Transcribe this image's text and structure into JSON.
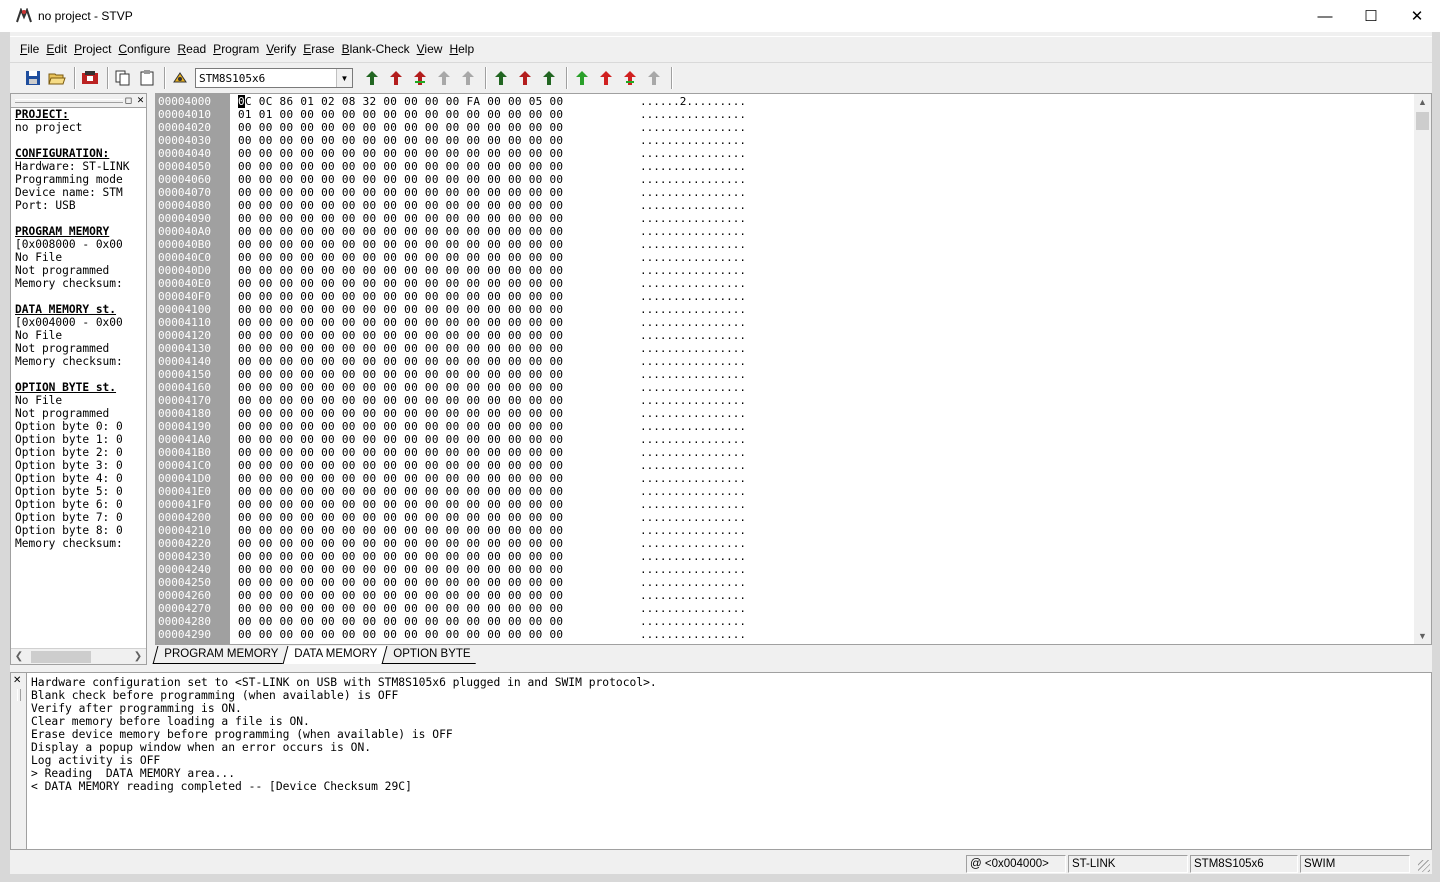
{
  "window": {
    "title": "no project - STVP"
  },
  "menu": [
    {
      "label": "File",
      "u": "F",
      "rest": "ile"
    },
    {
      "label": "Edit",
      "u": "E",
      "rest": "dit"
    },
    {
      "label": "Project",
      "u": "P",
      "rest": "roject"
    },
    {
      "label": "Configure",
      "u": "C",
      "rest": "onfigure"
    },
    {
      "label": "Read",
      "u": "R",
      "rest": "ead"
    },
    {
      "label": "Program",
      "u": "P",
      "rest": "rogram"
    },
    {
      "label": "Verify",
      "u": "V",
      "rest": "erify"
    },
    {
      "label": "Erase",
      "u": "E",
      "rest": "rase"
    },
    {
      "label": "Blank-Check",
      "u": "B",
      "rest": "lank-Check"
    },
    {
      "label": "View",
      "u": "V",
      "rest": "iew"
    },
    {
      "label": "Help",
      "u": "H",
      "rest": "elp"
    }
  ],
  "toolbar": {
    "device": "STM8S105x6"
  },
  "left_panel": {
    "lines": [
      {
        "t": "PROJECT:",
        "h": true
      },
      {
        "t": "no project"
      },
      {
        "t": ""
      },
      {
        "t": "CONFIGURATION:",
        "h": true
      },
      {
        "t": "Hardware: ST-LINK"
      },
      {
        "t": "Programming mode"
      },
      {
        "t": "Device name: STM"
      },
      {
        "t": "Port: USB"
      },
      {
        "t": ""
      },
      {
        "t": "PROGRAM MEMORY",
        "h": true
      },
      {
        "t": "[0x008000 - 0x00"
      },
      {
        "t": "No File"
      },
      {
        "t": "Not programmed"
      },
      {
        "t": "Memory checksum:"
      },
      {
        "t": ""
      },
      {
        "t": "DATA MEMORY st.",
        "h": true
      },
      {
        "t": "[0x004000 - 0x00"
      },
      {
        "t": "No File"
      },
      {
        "t": "Not programmed"
      },
      {
        "t": "Memory checksum:"
      },
      {
        "t": ""
      },
      {
        "t": "OPTION BYTE st.",
        "h": true
      },
      {
        "t": "No File"
      },
      {
        "t": "Not programmed"
      },
      {
        "t": "Option byte 0: 0"
      },
      {
        "t": "Option byte 1: 0"
      },
      {
        "t": "Option byte 2: 0"
      },
      {
        "t": "Option byte 3: 0"
      },
      {
        "t": "Option byte 4: 0"
      },
      {
        "t": "Option byte 5: 0"
      },
      {
        "t": "Option byte 6: 0"
      },
      {
        "t": "Option byte 7: 0"
      },
      {
        "t": "Option byte 8: 0"
      },
      {
        "t": "Memory checksum:"
      }
    ]
  },
  "hex": {
    "rows": [
      {
        "addr": "00004000",
        "bytes": "0C 0C 86 01 02 08 32 00 00 00 00 FA 00 00 05 00",
        "ascii": "......2........."
      },
      {
        "addr": "00004010",
        "bytes": "01 01 00 00 00 00 00 00 00 00 00 00 00 00 00 00",
        "ascii": "................"
      },
      {
        "addr": "00004020",
        "bytes": "00 00 00 00 00 00 00 00 00 00 00 00 00 00 00 00",
        "ascii": "................"
      },
      {
        "addr": "00004030",
        "bytes": "00 00 00 00 00 00 00 00 00 00 00 00 00 00 00 00",
        "ascii": "................"
      },
      {
        "addr": "00004040",
        "bytes": "00 00 00 00 00 00 00 00 00 00 00 00 00 00 00 00",
        "ascii": "................"
      },
      {
        "addr": "00004050",
        "bytes": "00 00 00 00 00 00 00 00 00 00 00 00 00 00 00 00",
        "ascii": "................"
      },
      {
        "addr": "00004060",
        "bytes": "00 00 00 00 00 00 00 00 00 00 00 00 00 00 00 00",
        "ascii": "................"
      },
      {
        "addr": "00004070",
        "bytes": "00 00 00 00 00 00 00 00 00 00 00 00 00 00 00 00",
        "ascii": "................"
      },
      {
        "addr": "00004080",
        "bytes": "00 00 00 00 00 00 00 00 00 00 00 00 00 00 00 00",
        "ascii": "................"
      },
      {
        "addr": "00004090",
        "bytes": "00 00 00 00 00 00 00 00 00 00 00 00 00 00 00 00",
        "ascii": "................"
      },
      {
        "addr": "000040A0",
        "bytes": "00 00 00 00 00 00 00 00 00 00 00 00 00 00 00 00",
        "ascii": "................"
      },
      {
        "addr": "000040B0",
        "bytes": "00 00 00 00 00 00 00 00 00 00 00 00 00 00 00 00",
        "ascii": "................"
      },
      {
        "addr": "000040C0",
        "bytes": "00 00 00 00 00 00 00 00 00 00 00 00 00 00 00 00",
        "ascii": "................"
      },
      {
        "addr": "000040D0",
        "bytes": "00 00 00 00 00 00 00 00 00 00 00 00 00 00 00 00",
        "ascii": "................"
      },
      {
        "addr": "000040E0",
        "bytes": "00 00 00 00 00 00 00 00 00 00 00 00 00 00 00 00",
        "ascii": "................"
      },
      {
        "addr": "000040F0",
        "bytes": "00 00 00 00 00 00 00 00 00 00 00 00 00 00 00 00",
        "ascii": "................"
      },
      {
        "addr": "00004100",
        "bytes": "00 00 00 00 00 00 00 00 00 00 00 00 00 00 00 00",
        "ascii": "................"
      },
      {
        "addr": "00004110",
        "bytes": "00 00 00 00 00 00 00 00 00 00 00 00 00 00 00 00",
        "ascii": "................"
      },
      {
        "addr": "00004120",
        "bytes": "00 00 00 00 00 00 00 00 00 00 00 00 00 00 00 00",
        "ascii": "................"
      },
      {
        "addr": "00004130",
        "bytes": "00 00 00 00 00 00 00 00 00 00 00 00 00 00 00 00",
        "ascii": "................"
      },
      {
        "addr": "00004140",
        "bytes": "00 00 00 00 00 00 00 00 00 00 00 00 00 00 00 00",
        "ascii": "................"
      },
      {
        "addr": "00004150",
        "bytes": "00 00 00 00 00 00 00 00 00 00 00 00 00 00 00 00",
        "ascii": "................"
      },
      {
        "addr": "00004160",
        "bytes": "00 00 00 00 00 00 00 00 00 00 00 00 00 00 00 00",
        "ascii": "................"
      },
      {
        "addr": "00004170",
        "bytes": "00 00 00 00 00 00 00 00 00 00 00 00 00 00 00 00",
        "ascii": "................"
      },
      {
        "addr": "00004180",
        "bytes": "00 00 00 00 00 00 00 00 00 00 00 00 00 00 00 00",
        "ascii": "................"
      },
      {
        "addr": "00004190",
        "bytes": "00 00 00 00 00 00 00 00 00 00 00 00 00 00 00 00",
        "ascii": "................"
      },
      {
        "addr": "000041A0",
        "bytes": "00 00 00 00 00 00 00 00 00 00 00 00 00 00 00 00",
        "ascii": "................"
      },
      {
        "addr": "000041B0",
        "bytes": "00 00 00 00 00 00 00 00 00 00 00 00 00 00 00 00",
        "ascii": "................"
      },
      {
        "addr": "000041C0",
        "bytes": "00 00 00 00 00 00 00 00 00 00 00 00 00 00 00 00",
        "ascii": "................"
      },
      {
        "addr": "000041D0",
        "bytes": "00 00 00 00 00 00 00 00 00 00 00 00 00 00 00 00",
        "ascii": "................"
      },
      {
        "addr": "000041E0",
        "bytes": "00 00 00 00 00 00 00 00 00 00 00 00 00 00 00 00",
        "ascii": "................"
      },
      {
        "addr": "000041F0",
        "bytes": "00 00 00 00 00 00 00 00 00 00 00 00 00 00 00 00",
        "ascii": "................"
      },
      {
        "addr": "00004200",
        "bytes": "00 00 00 00 00 00 00 00 00 00 00 00 00 00 00 00",
        "ascii": "................"
      },
      {
        "addr": "00004210",
        "bytes": "00 00 00 00 00 00 00 00 00 00 00 00 00 00 00 00",
        "ascii": "................"
      },
      {
        "addr": "00004220",
        "bytes": "00 00 00 00 00 00 00 00 00 00 00 00 00 00 00 00",
        "ascii": "................"
      },
      {
        "addr": "00004230",
        "bytes": "00 00 00 00 00 00 00 00 00 00 00 00 00 00 00 00",
        "ascii": "................"
      },
      {
        "addr": "00004240",
        "bytes": "00 00 00 00 00 00 00 00 00 00 00 00 00 00 00 00",
        "ascii": "................"
      },
      {
        "addr": "00004250",
        "bytes": "00 00 00 00 00 00 00 00 00 00 00 00 00 00 00 00",
        "ascii": "................"
      },
      {
        "addr": "00004260",
        "bytes": "00 00 00 00 00 00 00 00 00 00 00 00 00 00 00 00",
        "ascii": "................"
      },
      {
        "addr": "00004270",
        "bytes": "00 00 00 00 00 00 00 00 00 00 00 00 00 00 00 00",
        "ascii": "................"
      },
      {
        "addr": "00004280",
        "bytes": "00 00 00 00 00 00 00 00 00 00 00 00 00 00 00 00",
        "ascii": "................"
      },
      {
        "addr": "00004290",
        "bytes": "00 00 00 00 00 00 00 00 00 00 00 00 00 00 00 00",
        "ascii": "................"
      }
    ]
  },
  "tabs": [
    {
      "label": "PROGRAM MEMORY",
      "active": false
    },
    {
      "label": "DATA MEMORY",
      "active": true
    },
    {
      "label": "OPTION BYTE",
      "active": false
    }
  ],
  "log": {
    "lines": [
      "Hardware configuration set to <ST-LINK on USB with STM8S105x6 plugged in and SWIM protocol>.",
      "Blank check before programming (when available) is OFF",
      "Verify after programming is ON.",
      "Clear memory before loading a file is ON.",
      "Erase device memory before programming (when available) is OFF",
      "Display a popup window when an error occurs is ON.",
      "Log activity is OFF",
      "> Reading  DATA MEMORY area...",
      "< DATA MEMORY reading completed -- [Device Checksum 29C]"
    ]
  },
  "status": {
    "address": "@ <0x004000>",
    "hardware": "ST-LINK",
    "device": "STM8S105x6",
    "protocol": "SWIM"
  },
  "icons": {
    "save": "save-icon",
    "open": "open-icon",
    "project": "project-icon",
    "copy": "copy-icon",
    "paste": "paste-icon",
    "connect": "connect-icon",
    "read": "read-icon",
    "program": "program-icon",
    "verify": "verify-icon"
  }
}
